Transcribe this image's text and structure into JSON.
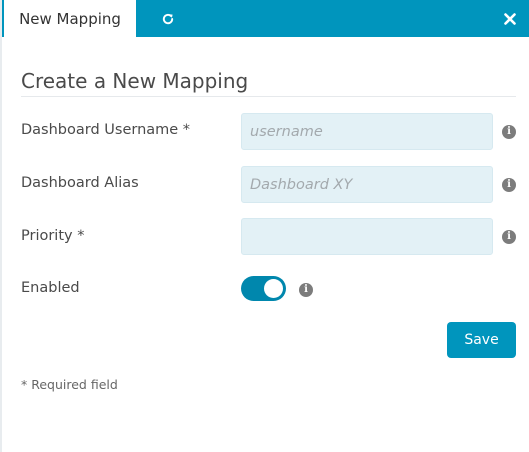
{
  "tabs": {
    "active_label": "New Mapping",
    "refresh_icon": "refresh-icon",
    "close_icon": "close-icon"
  },
  "form": {
    "title": "Create a New Mapping",
    "fields": {
      "username": {
        "label": "Dashboard Username *",
        "placeholder": "username",
        "value": ""
      },
      "alias": {
        "label": "Dashboard Alias",
        "placeholder": "Dashboard XY",
        "value": ""
      },
      "priority": {
        "label": "Priority *",
        "placeholder": "",
        "value": ""
      },
      "enabled": {
        "label": "Enabled",
        "checked": true
      }
    },
    "save_label": "Save",
    "required_note": "* Required field",
    "info_glyph": "i"
  },
  "colors": {
    "accent": "#0095bd",
    "field_bg": "#e3f1f6",
    "toggle_on": "#0087ad",
    "info_icon": "#7c7c7c"
  }
}
